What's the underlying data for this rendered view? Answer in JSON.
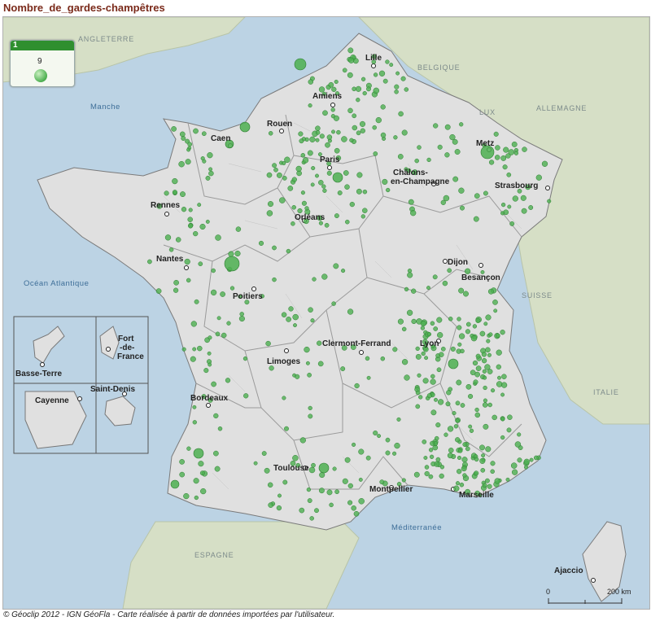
{
  "title": "Nombre_de_gardes-champêtres",
  "legend": {
    "header": "1",
    "value": "9"
  },
  "footer": "© Géoclip 2012 - IGN GéoFla - Carte réalisée à partir de données importées par l'utilisateur.",
  "cities": [
    "Lille",
    "Amiens",
    "Rouen",
    "Caen",
    "Paris",
    "Metz",
    "Châlons-",
    "en-Champagne",
    "Strasbourg",
    "Rennes",
    "Orléans",
    "Nantes",
    "Dijon",
    "Besançon",
    "Poitiers",
    "Lyon",
    "Clermont-Ferrand",
    "Limoges",
    "Bordeaux",
    "Toulouse",
    "Montpellier",
    "Marseille",
    "Ajaccio"
  ],
  "seas": [
    "Manche",
    "Océan Atlantique",
    "Méditerranée"
  ],
  "countries": [
    "ANGLETERRE",
    "BELGIQUE",
    "LUX",
    "ALLEMAGNE",
    "SUISSE",
    "ITALIE",
    "ESPAGNE"
  ],
  "overseas": [
    "Basse-Terre",
    "Fort",
    "-de-",
    "France",
    "Cayenne",
    "Saint-Denis"
  ],
  "scale": {
    "zero": "0",
    "max": "200 km"
  },
  "colors": {
    "sea": "#bcd3e4",
    "land_abroad": "#d6dfc6",
    "france": "#e0e0e0",
    "marker": "#4caf50"
  }
}
